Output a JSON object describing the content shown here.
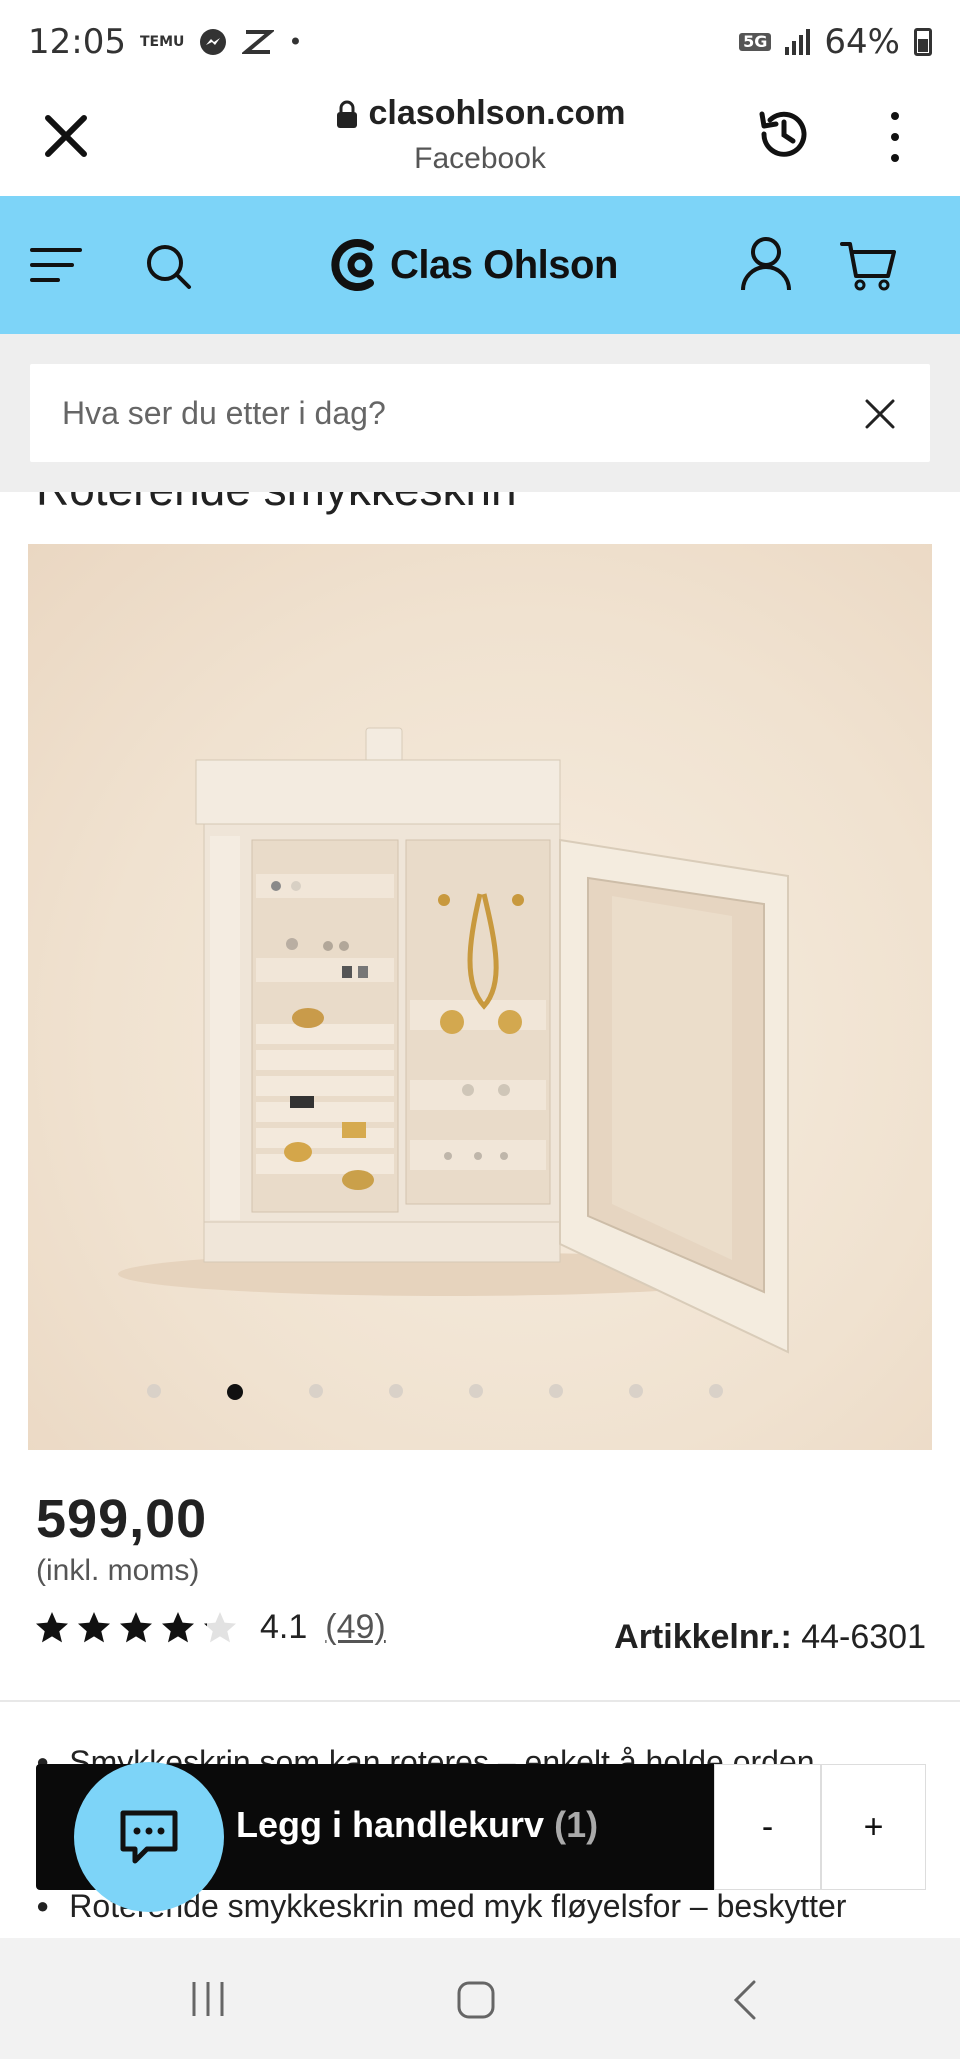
{
  "status_bar": {
    "time": "12:05",
    "temu_badge": "TEMU",
    "network": "5G",
    "battery": "64%"
  },
  "browser": {
    "url": "clasohlson.com",
    "source": "Facebook",
    "icons": [
      "close-icon",
      "lock-icon",
      "history-icon",
      "more-vert-icon"
    ]
  },
  "header": {
    "brand": "Clas Ohlson",
    "accent_color": "#7dd4f8",
    "icons": [
      "menu-icon",
      "search-icon",
      "user-icon",
      "cart-icon"
    ]
  },
  "search": {
    "placeholder": "Hva ser du etter i dag?"
  },
  "product": {
    "title": "Roterende smykkeskrin",
    "image_count": 8,
    "active_image_index": 1,
    "price": "599,00",
    "vat_note": "(inkl. moms)",
    "rating": {
      "value": "4.1",
      "count": "(49)",
      "stars": 4.1
    },
    "article_label": "Artikkelnr.:",
    "article_number": "44-6301",
    "bullets": [
      "Smykkeskrin som kan roteres – enkelt å holde orden",
      "Roterende smykkeskrin med myk fløyelsfor – beskytter"
    ]
  },
  "cart": {
    "label": "Legg i handlekurv",
    "count": "(1)",
    "minus": "-",
    "plus": "+"
  },
  "nav": {
    "icons": [
      "recent-apps-icon",
      "home-icon",
      "back-icon"
    ]
  }
}
